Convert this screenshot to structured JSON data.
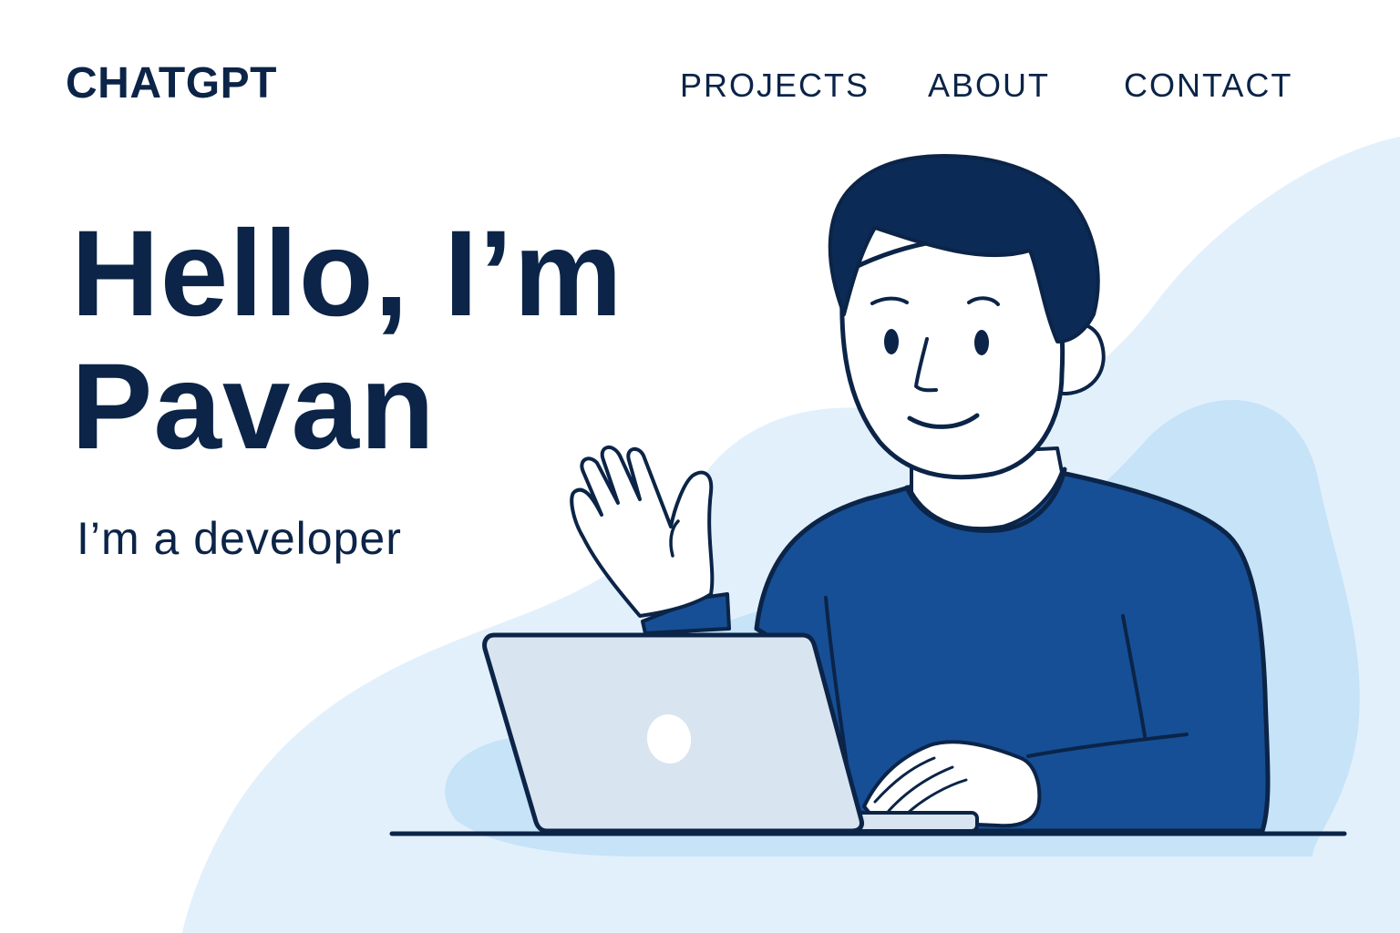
{
  "header": {
    "brand": "CHATGPT",
    "nav": [
      {
        "label": "PROJECTS"
      },
      {
        "label": "ABOUT"
      },
      {
        "label": "CONTACT"
      }
    ]
  },
  "hero": {
    "title_line1": "Hello, I’m",
    "title_line2": "Pavan",
    "subtitle": "I’m a developer"
  },
  "illustration": {
    "subject": "person-waving-at-laptop",
    "colors": {
      "text": "#0b2447",
      "outline": "#0b2447",
      "hair": "#0b2a55",
      "sweater": "#164f96",
      "laptop": "#d8e4f0",
      "blob_light": "#e2f0fc",
      "blob_mid": "#c6e3f8",
      "background": "#ffffff"
    }
  }
}
